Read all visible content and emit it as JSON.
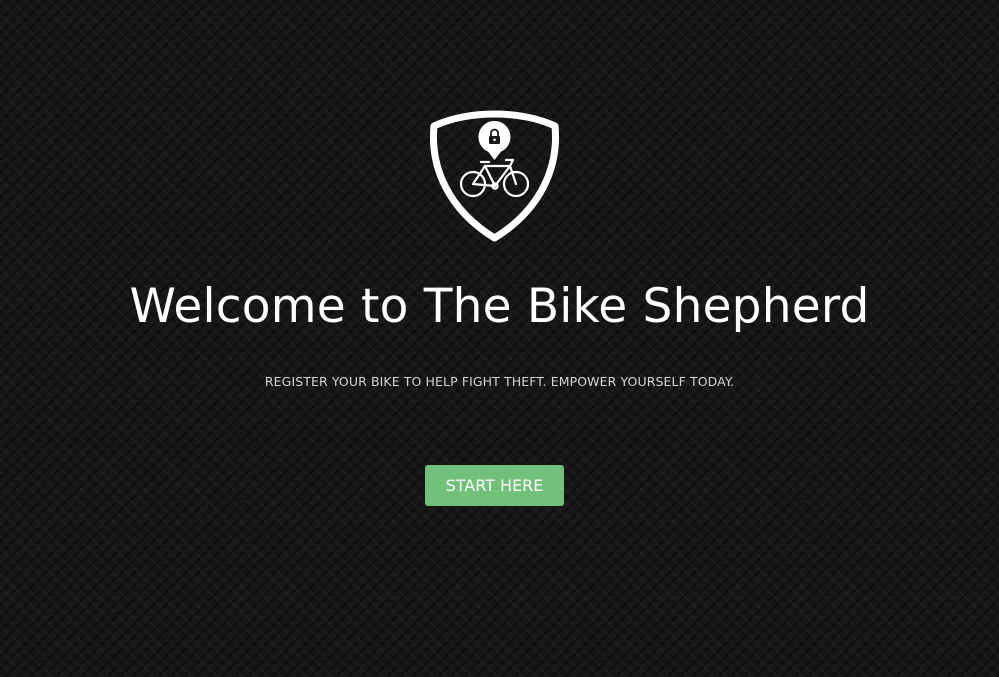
{
  "hero": {
    "logo_icon": "bike-shield-lock-icon",
    "title": "Welcome to The Bike Shepherd",
    "subtitle": "REGISTER YOUR BIKE TO HELP FIGHT THEFT. EMPOWER YOURSELF TODAY.",
    "cta_label": "START HERE"
  },
  "colors": {
    "background": "#161616",
    "text": "#ffffff",
    "subtitle_text": "#d4d4d4",
    "cta_background": "#72c17a"
  }
}
